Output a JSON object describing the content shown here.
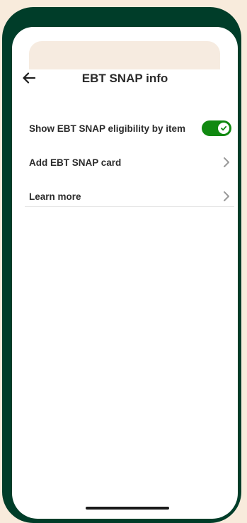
{
  "header": {
    "title": "EBT SNAP info",
    "back_icon": "arrow-left-icon"
  },
  "settings": {
    "toggle_row": {
      "label": "Show EBT SNAP eligibility by item",
      "toggle_state": "on",
      "toggle_color": "#108910"
    },
    "add_card_row": {
      "label": "Add EBT SNAP card",
      "icon": "chevron-right-icon"
    },
    "learn_more_row": {
      "label": "Learn more",
      "icon": "chevron-right-icon"
    }
  },
  "theme": {
    "frame_color": "#003d29",
    "background_color": "#f8ebdc",
    "text_color": "#2b2b2b"
  }
}
